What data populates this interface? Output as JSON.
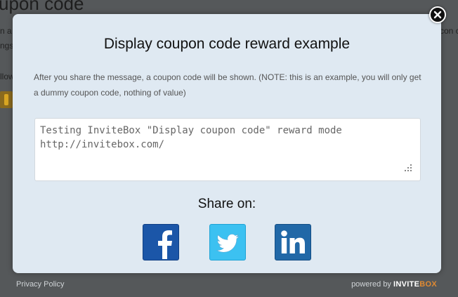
{
  "background_page": {
    "title_fragment": "upon code",
    "line1_left": "n a",
    "line2_left": "ngs",
    "line3_left": "llow",
    "line1_right": "con c"
  },
  "modal": {
    "title": "Display coupon code reward example",
    "description": "After you share the message, a coupon code will be shown. (NOTE: this is an example, you will only get a dummy coupon code, nothing of value)",
    "message_text": "Testing InviteBox \"Display coupon code\" reward mode\nhttp://invitebox.com/",
    "share_heading": "Share on:",
    "share_buttons": [
      {
        "network": "facebook",
        "icon": "facebook-icon",
        "color": "#1b56a8"
      },
      {
        "network": "twitter",
        "icon": "twitter-bird-icon",
        "color": "#3cc1f1"
      },
      {
        "network": "linkedin",
        "icon": "linkedin-icon",
        "color": "#2168a7"
      }
    ],
    "close_icon": "close-icon"
  },
  "footer": {
    "privacy_link": "Privacy Policy",
    "powered_by": "powered by",
    "brand_part1": "INVITE",
    "brand_part2": "BOX",
    "brand_color": "#e08a32"
  }
}
